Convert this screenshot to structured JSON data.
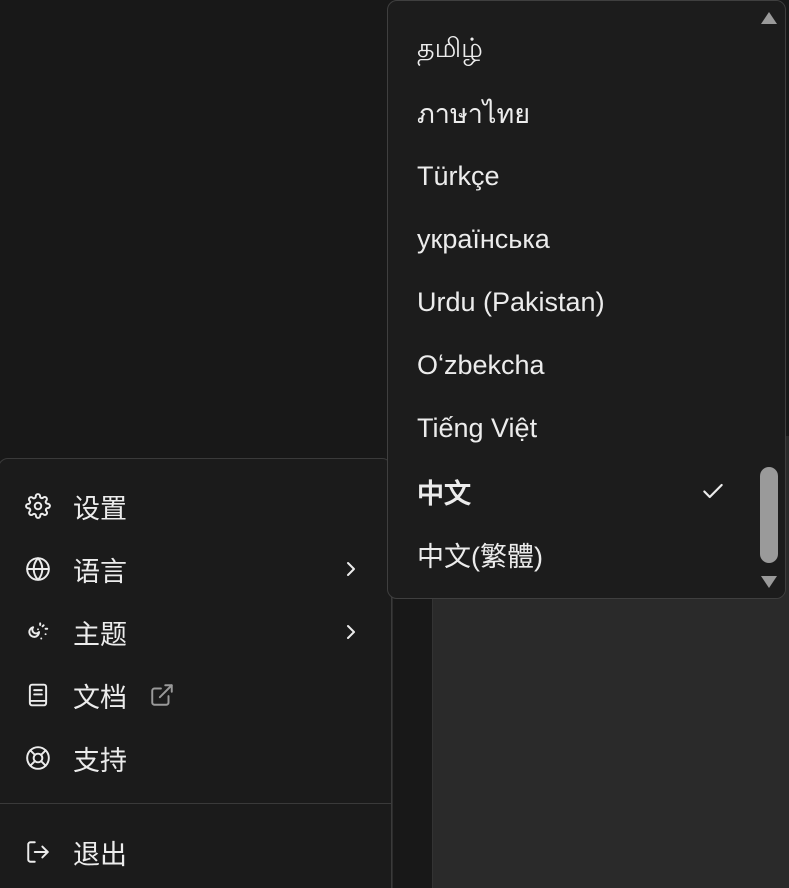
{
  "main_menu": {
    "items": [
      {
        "label": "设置",
        "icon": "gear-icon"
      },
      {
        "label": "语言",
        "icon": "globe-icon",
        "has_submenu": true
      },
      {
        "label": "主题",
        "icon": "theme-icon",
        "has_submenu": true
      },
      {
        "label": "文档",
        "icon": "book-icon",
        "external": true
      },
      {
        "label": "支持",
        "icon": "lifebuoy-icon"
      }
    ],
    "logout": {
      "label": "退出",
      "icon": "logout-icon"
    }
  },
  "language_menu": {
    "items": [
      {
        "label": "தமிழ்"
      },
      {
        "label": "ภาษาไทย"
      },
      {
        "label": "Türkçe"
      },
      {
        "label": "українська"
      },
      {
        "label": "Urdu (Pakistan)"
      },
      {
        "label": "Oʻzbekcha"
      },
      {
        "label": "Tiếng Việt"
      },
      {
        "label": "中文",
        "selected": true
      },
      {
        "label": "中文(繁體)"
      }
    ]
  },
  "colors": {
    "background": "#181818",
    "menu_bg": "#1b1b1b",
    "text": "#ececec",
    "scroll_thumb": "#9a9a9a"
  }
}
